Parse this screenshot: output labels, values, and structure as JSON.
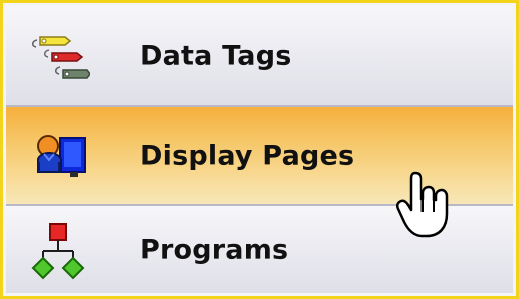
{
  "menu": {
    "items": [
      {
        "label": "Data Tags",
        "icon": "data-tags-icon",
        "state": "normal"
      },
      {
        "label": "Display Pages",
        "icon": "display-pages-icon",
        "state": "active"
      },
      {
        "label": "Programs",
        "icon": "programs-icon",
        "state": "normal"
      }
    ]
  },
  "pointer": {
    "icon": "hand-cursor-icon"
  },
  "colors": {
    "frame_border": "#f2d51a",
    "active_highlight": "#f6b03d",
    "separator": "#b8b8c6"
  }
}
